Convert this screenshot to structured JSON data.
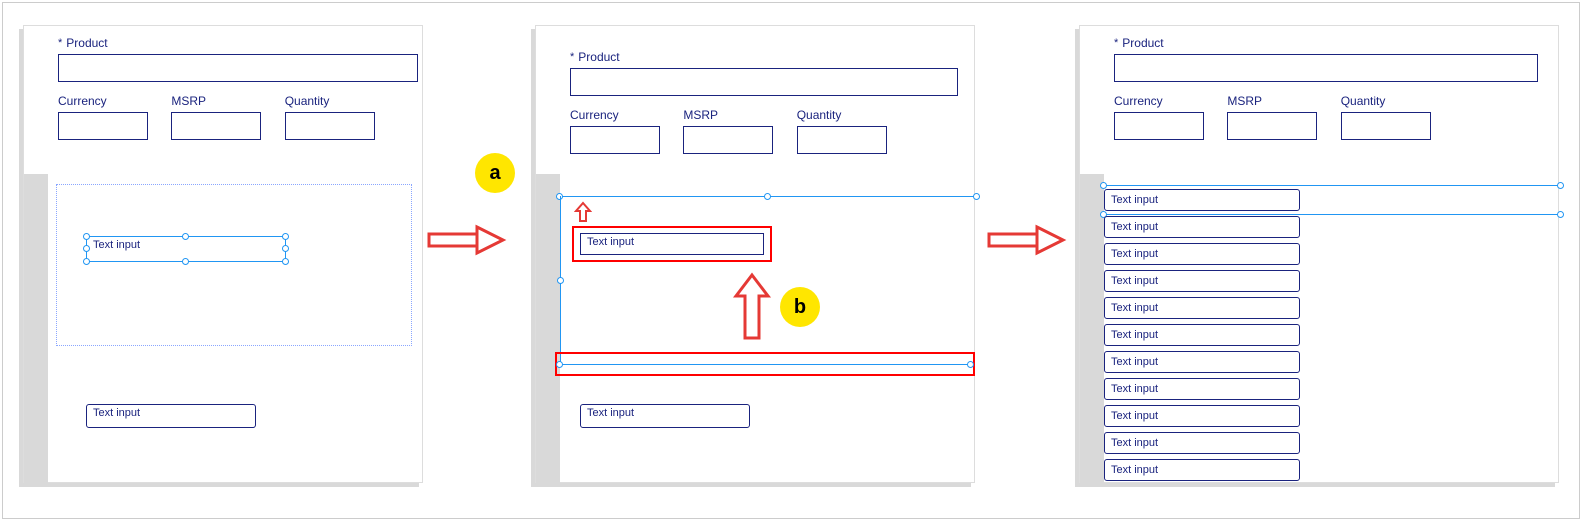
{
  "labels": {
    "product": "Product",
    "currency": "Currency",
    "msrp": "MSRP",
    "quantity": "Quantity",
    "text_input": "Text input",
    "asterisk": "*"
  },
  "annotations": {
    "a": "a",
    "b": "b"
  },
  "panel3_rows": 11
}
